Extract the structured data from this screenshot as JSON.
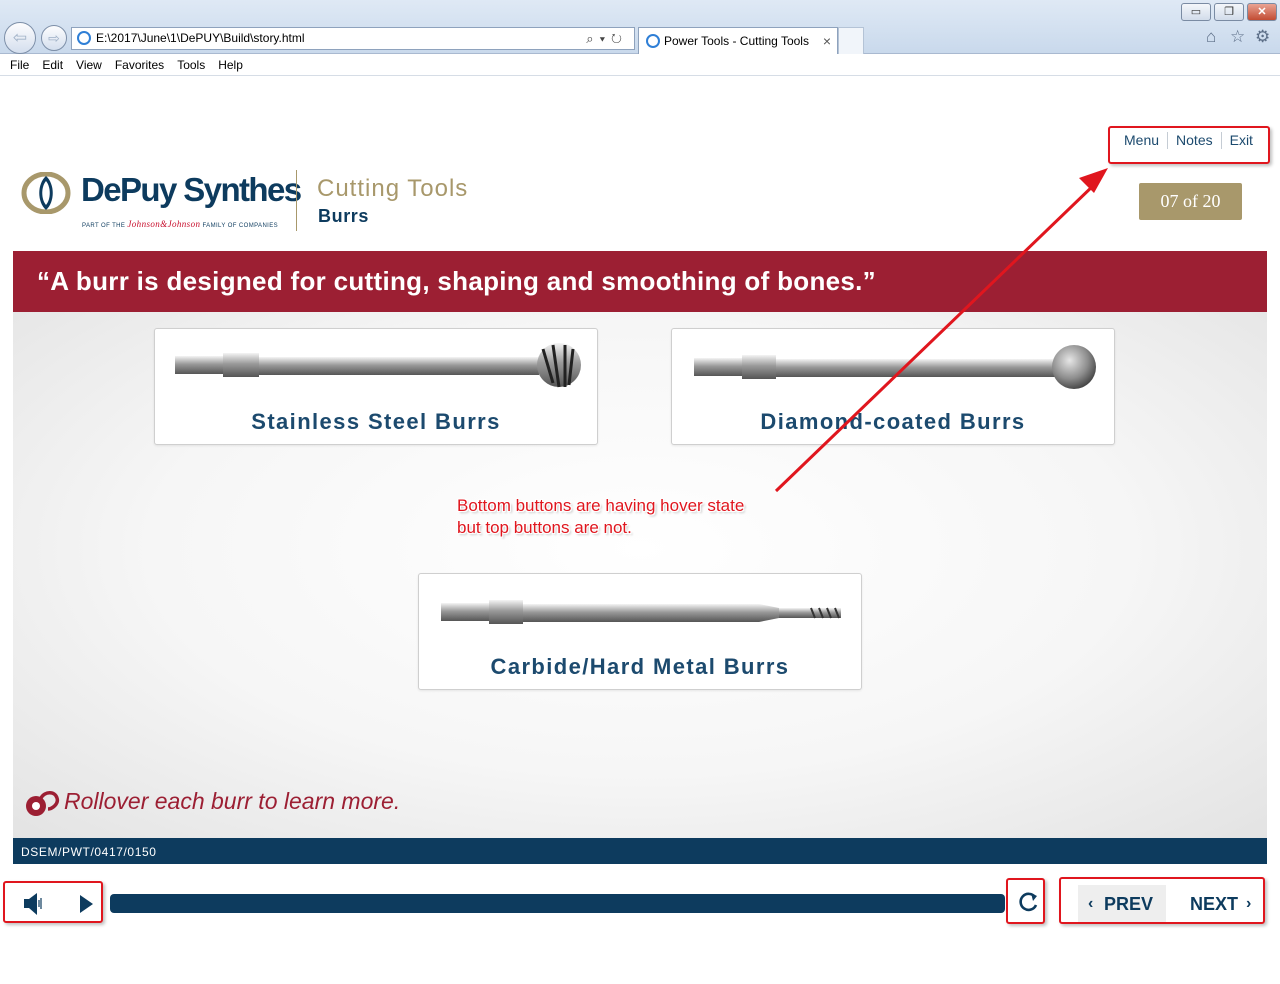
{
  "browser": {
    "address": "E:\\2017\\June\\1\\DePUY\\Build\\story.html",
    "tab_title": "Power Tools - Cutting Tools",
    "tab_close": "×",
    "address_tools": "⌕▾↻",
    "menu": [
      "File",
      "Edit",
      "View",
      "Favorites",
      "Tools",
      "Help"
    ],
    "window_controls": {
      "minimize": "▭",
      "restore": "❐",
      "close": "✕"
    },
    "toolbar_icons": {
      "home": "⌂",
      "favorites": "☆",
      "settings": "⚙"
    }
  },
  "course": {
    "brand": {
      "name": "DePuy Synthes",
      "tagline_pre": "PART OF THE ",
      "tagline_brand": "Johnson&Johnson",
      "tagline_post": " FAMILY OF COMPANIES"
    },
    "title": "Cutting Tools",
    "subtitle": "Burrs",
    "top_nav": {
      "menu": "Menu",
      "notes": "Notes",
      "exit": "Exit"
    },
    "page_counter": "07 of 20",
    "quote": "“A burr is designed for cutting, shaping and smoothing of bones.”",
    "burrs": [
      {
        "label": "Stainless Steel Burrs",
        "icon": "stainless-steel-burr"
      },
      {
        "label": "Diamond-coated Burrs",
        "icon": "diamond-coated-burr"
      },
      {
        "label": "Carbide/Hard Metal Burrs",
        "icon": "carbide-burr"
      }
    ],
    "hint": "Rollover each burr to learn more.",
    "footer_code": "DSEM/PWT/0417/0150",
    "player": {
      "prev_label": "PREV",
      "next_label": "NEXT",
      "progress": 1.0
    }
  },
  "annotation": {
    "text_line1": "Bottom buttons are having hover state",
    "text_line2": "but top buttons are not.",
    "color": "#e0161e"
  },
  "colors": {
    "brand_navy": "#0d3b5e",
    "brand_red": "#9c1f33",
    "gold": "#a8986b"
  }
}
